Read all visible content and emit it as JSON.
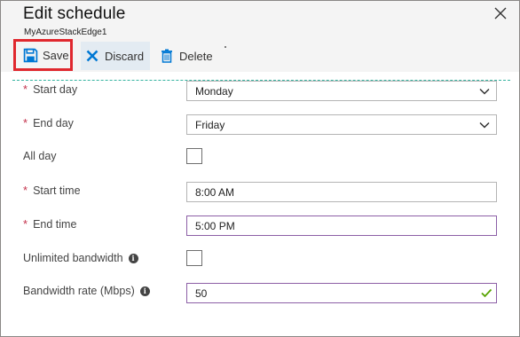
{
  "panel": {
    "title": "Edit schedule",
    "subtitle": "MyAzureStackEdge1"
  },
  "toolbar": {
    "save_label": "Save",
    "discard_label": "Discard",
    "delete_label": "Delete"
  },
  "form": {
    "start_day": {
      "label": "Start day",
      "value": "Monday",
      "required": true
    },
    "end_day": {
      "label": "End day",
      "value": "Friday",
      "required": true
    },
    "all_day": {
      "label": "All day",
      "checked": false
    },
    "start_time": {
      "label": "Start time",
      "value": "8:00 AM",
      "required": true
    },
    "end_time": {
      "label": "End time",
      "value": "5:00 PM",
      "required": true
    },
    "unlimited_bandwidth": {
      "label": "Unlimited bandwidth",
      "checked": false
    },
    "bandwidth_rate": {
      "label": "Bandwidth rate (Mbps)",
      "value": "50"
    }
  },
  "glyphs": {
    "required_marker": "*",
    "info_marker": "i"
  },
  "colors": {
    "accent": "#0078d4",
    "required": "#c4314b",
    "focus_border": "#8c5fa6",
    "valid_check": "#57a300",
    "highlight_border": "#e0282e",
    "divider": "#34b3a0"
  },
  "icons": {
    "close": "close-icon",
    "save": "save-icon",
    "discard": "discard-icon",
    "delete": "delete-icon",
    "dropdown": "chevron-down-icon",
    "info": "info-icon",
    "valid": "checkmark-icon"
  }
}
